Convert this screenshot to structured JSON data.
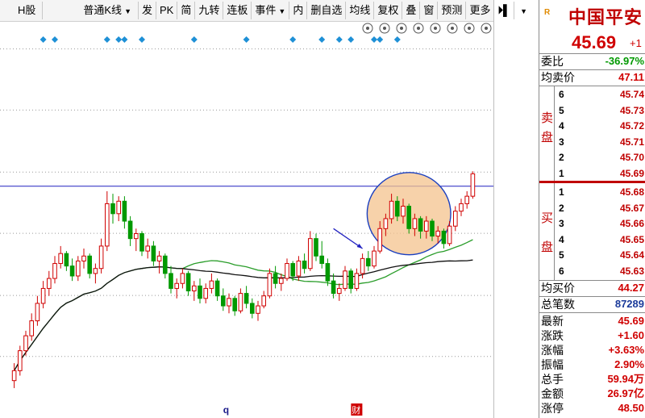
{
  "toolbar": {
    "items": [
      "H股",
      "普通K线",
      "发",
      "PK",
      "简",
      "九转",
      "连板",
      "事件",
      "内",
      "删自选",
      "均线",
      "复权",
      "叠",
      "窗",
      "预测",
      "更多"
    ],
    "icons": [
      "eye-icon",
      "hand-icon",
      "play-icon",
      "undo-icon",
      "scissors-icon",
      "lock-icon",
      "zoom-in-icon",
      "zoom-out-icon"
    ]
  },
  "colors": {
    "up": "#d00000",
    "down": "#009900",
    "price_axis": "#d00000",
    "ma_black": "#111111",
    "ma_green": "#2a9d2a",
    "hline": "#2020c0",
    "diamond": "#1e90d6",
    "ellipse_fill": "#f4c38e",
    "ellipse_stroke": "#1a3fc0"
  },
  "chart_data": {
    "type": "candlestick",
    "yticks": [
      "50.21",
      "47.76",
      "45.27",
      "42.81",
      "40.32",
      "37.87"
    ],
    "ylim": [
      35.4,
      51.3
    ],
    "horizontal_line": 44.7,
    "event_markers": [
      "q",
      "财"
    ],
    "candles": [
      [
        36.9,
        37.6,
        36.6,
        37.3
      ],
      [
        37.3,
        38.3,
        37.1,
        38.1
      ],
      [
        38.1,
        38.9,
        37.9,
        38.7
      ],
      [
        38.7,
        39.6,
        38.5,
        39.3
      ],
      [
        39.3,
        40.3,
        39.1,
        40.0
      ],
      [
        40.0,
        40.9,
        39.8,
        40.6
      ],
      [
        40.6,
        41.3,
        40.3,
        41.0
      ],
      [
        41.0,
        41.9,
        40.8,
        41.6
      ],
      [
        41.6,
        42.3,
        41.4,
        42.0
      ],
      [
        42.0,
        42.1,
        41.3,
        41.5
      ],
      [
        41.5,
        41.8,
        40.9,
        41.1
      ],
      [
        41.1,
        41.9,
        40.9,
        41.7
      ],
      [
        41.7,
        42.2,
        41.4,
        41.9
      ],
      [
        41.9,
        42.0,
        41.0,
        41.2
      ],
      [
        41.2,
        41.6,
        40.8,
        41.4
      ],
      [
        41.4,
        42.6,
        41.2,
        42.3
      ],
      [
        42.3,
        44.5,
        42.1,
        44.0
      ],
      [
        44.0,
        44.4,
        43.2,
        43.6
      ],
      [
        43.6,
        44.3,
        43.3,
        44.1
      ],
      [
        44.1,
        44.3,
        43.0,
        43.3
      ],
      [
        43.3,
        43.5,
        42.3,
        42.6
      ],
      [
        42.6,
        43.0,
        42.1,
        42.8
      ],
      [
        42.8,
        42.9,
        41.9,
        42.1
      ],
      [
        42.1,
        42.6,
        41.8,
        42.3
      ],
      [
        42.3,
        42.5,
        41.5,
        41.7
      ],
      [
        41.7,
        42.1,
        41.2,
        41.9
      ],
      [
        41.9,
        42.0,
        41.0,
        41.2
      ],
      [
        41.2,
        41.5,
        40.4,
        40.6
      ],
      [
        40.6,
        41.0,
        40.2,
        40.8
      ],
      [
        40.8,
        41.4,
        40.6,
        41.2
      ],
      [
        41.2,
        41.3,
        40.3,
        40.5
      ],
      [
        40.5,
        40.9,
        40.1,
        40.7
      ],
      [
        40.7,
        41.0,
        40.0,
        40.2
      ],
      [
        40.2,
        40.8,
        40.0,
        40.6
      ],
      [
        40.6,
        41.2,
        40.4,
        40.9
      ],
      [
        40.9,
        41.0,
        40.1,
        40.3
      ],
      [
        40.3,
        40.6,
        39.7,
        39.9
      ],
      [
        39.9,
        40.4,
        39.6,
        40.2
      ],
      [
        40.2,
        40.3,
        39.5,
        39.7
      ],
      [
        39.7,
        40.6,
        39.6,
        40.4
      ],
      [
        40.4,
        40.7,
        39.8,
        40.0
      ],
      [
        40.0,
        40.2,
        39.4,
        39.6
      ],
      [
        39.6,
        40.1,
        39.3,
        39.9
      ],
      [
        39.9,
        40.5,
        39.8,
        40.3
      ],
      [
        40.3,
        41.4,
        40.2,
        41.2
      ],
      [
        41.2,
        41.5,
        40.6,
        40.8
      ],
      [
        40.8,
        41.2,
        40.5,
        41.0
      ],
      [
        41.0,
        41.8,
        40.9,
        41.6
      ],
      [
        41.6,
        41.7,
        40.9,
        41.1
      ],
      [
        41.1,
        41.9,
        40.9,
        41.7
      ],
      [
        41.7,
        42.0,
        41.2,
        41.4
      ],
      [
        41.4,
        42.9,
        41.3,
        42.6
      ],
      [
        42.6,
        42.8,
        41.7,
        41.9
      ],
      [
        41.9,
        42.5,
        41.4,
        41.6
      ],
      [
        41.6,
        41.8,
        40.7,
        40.9
      ],
      [
        40.9,
        41.2,
        40.2,
        40.4
      ],
      [
        40.4,
        40.8,
        40.1,
        40.6
      ],
      [
        40.6,
        41.5,
        40.5,
        41.3
      ],
      [
        41.3,
        41.4,
        40.4,
        40.6
      ],
      [
        40.6,
        41.4,
        40.5,
        41.2
      ],
      [
        41.2,
        42.0,
        41.0,
        41.8
      ],
      [
        41.8,
        42.1,
        41.3,
        41.5
      ],
      [
        41.5,
        42.3,
        41.4,
        42.1
      ],
      [
        42.1,
        43.3,
        42.0,
        43.0
      ],
      [
        43.0,
        43.6,
        42.7,
        43.4
      ],
      [
        43.4,
        44.4,
        43.2,
        44.1
      ],
      [
        44.1,
        44.3,
        43.3,
        43.5
      ],
      [
        43.5,
        44.2,
        43.2,
        43.9
      ],
      [
        43.9,
        44.0,
        42.8,
        43.0
      ],
      [
        43.0,
        43.6,
        42.7,
        43.4
      ],
      [
        43.4,
        43.5,
        42.6,
        42.9
      ],
      [
        42.9,
        43.5,
        42.6,
        43.3
      ],
      [
        43.3,
        43.4,
        42.5,
        42.7
      ],
      [
        42.7,
        43.1,
        42.4,
        42.9
      ],
      [
        42.9,
        43.0,
        42.2,
        42.4
      ],
      [
        42.4,
        43.3,
        42.3,
        43.1
      ],
      [
        43.1,
        43.9,
        42.9,
        43.7
      ],
      [
        43.7,
        44.2,
        43.5,
        44.0
      ],
      [
        44.0,
        44.5,
        43.8,
        44.3
      ],
      [
        44.3,
        45.3,
        44.2,
        45.2
      ]
    ]
  },
  "quote": {
    "logo": "R",
    "name": "中国平安",
    "price": "45.69",
    "change": "+1",
    "wei_bi_label": "委比",
    "wei_bi": "-36.97%",
    "jun_mai_label": "均卖价",
    "jun_mai": "47.11",
    "sell_label": [
      "卖",
      "盘"
    ],
    "sell_levels": [
      [
        "6",
        "45.74"
      ],
      [
        "5",
        "45.73"
      ],
      [
        "4",
        "45.72"
      ],
      [
        "3",
        "45.71"
      ],
      [
        "2",
        "45.70"
      ],
      [
        "1",
        "45.69"
      ]
    ],
    "buy_label": [
      "买",
      "盘"
    ],
    "buy_levels": [
      [
        "1",
        "45.68"
      ],
      [
        "2",
        "45.67"
      ],
      [
        "3",
        "45.66"
      ],
      [
        "4",
        "45.65"
      ],
      [
        "5",
        "45.64"
      ],
      [
        "6",
        "45.63"
      ]
    ],
    "jun_buy_label": "均买价",
    "jun_buy": "44.27",
    "zong_label": "总笔数",
    "zong": "87289",
    "stats": [
      [
        "最新",
        "45.69"
      ],
      [
        "涨跌",
        "+1.60"
      ],
      [
        "涨幅",
        "+3.63%"
      ],
      [
        "振幅",
        "2.90%"
      ],
      [
        "总手",
        "59.94万"
      ],
      [
        "金额",
        "26.97亿"
      ],
      [
        "涨停",
        "48.50"
      ]
    ]
  }
}
